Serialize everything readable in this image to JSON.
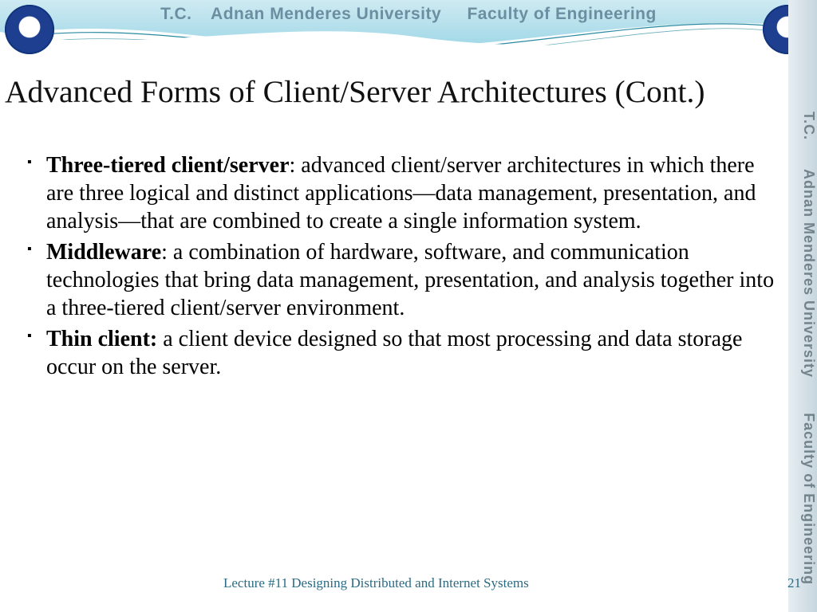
{
  "header": {
    "tc": "T.C.",
    "university": "Adnan Menderes University",
    "faculty": "Faculty of Engineering"
  },
  "title": "Advanced Forms of Client/Server Architectures (Cont.)",
  "bullets": [
    {
      "term": "Three-tiered client/server",
      "sep": ": ",
      "def": "advanced client/server architectures in which there are three logical and distinct applications—data management, presentation, and analysis—that are combined to create a single information system."
    },
    {
      "term": "Middleware",
      "sep": ": ",
      "def": "a combination of hardware, software, and communication technologies that bring data management, presentation, and analysis together into a three-tiered client/server environment."
    },
    {
      "term": "Thin client:",
      "sep": " ",
      "def": "a client device designed so that most processing and data storage occur on the server."
    }
  ],
  "footer": {
    "lecture": "Lecture #11 Designing Distributed and Internet Systems",
    "page": "21"
  },
  "colors": {
    "wave_light": "#bfe4ef",
    "wave_mid": "#7fcce0",
    "wave_line": "#2a8aa0",
    "footer_text": "#2a6b84"
  }
}
